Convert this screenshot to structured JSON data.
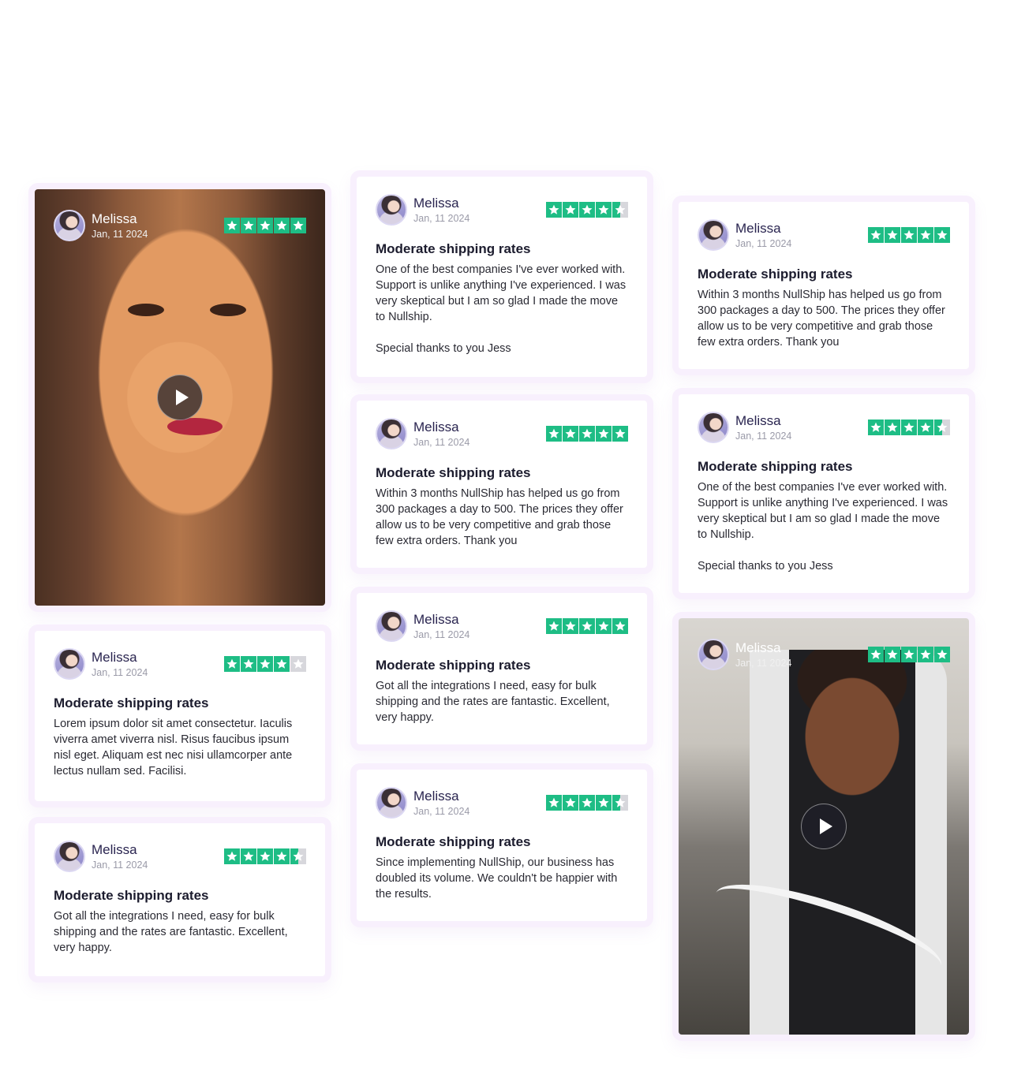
{
  "colors": {
    "star_on": "#1ebd85",
    "star_off": "#d7d7dc",
    "card_border": "#f8f0fd"
  },
  "cards": [
    {
      "kind": "video",
      "name": "Melissa",
      "date": "Jan, 11 2024",
      "rating": 5
    },
    {
      "kind": "text",
      "name": "Melissa",
      "date": "Jan, 11 2024",
      "rating": 4,
      "title": "Moderate shipping rates",
      "body": [
        "Lorem ipsum dolor sit amet consectetur. Iaculis viverra amet viverra nisl. Risus faucibus ipsum nisl eget. Aliquam est nec nisi ullamcorper ante lectus nullam sed. Facilisi."
      ]
    },
    {
      "kind": "text",
      "name": "Melissa",
      "date": "Jan, 11 2024",
      "rating": 4.5,
      "title": "Moderate shipping rates",
      "body": [
        "Got all the integrations I need, easy for bulk shipping and the rates are fantastic. Excellent, very happy."
      ]
    },
    {
      "kind": "text",
      "name": "Melissa",
      "date": "Jan, 11 2024",
      "rating": 4.5,
      "title": "Moderate shipping rates",
      "body": [
        "One of the best companies I've ever worked with. Support is unlike anything I've experienced. I was very skeptical but I am so glad I made the move to Nullship.",
        "Special thanks to you Jess"
      ]
    },
    {
      "kind": "text",
      "name": "Melissa",
      "date": "Jan, 11 2024",
      "rating": 5,
      "title": "Moderate shipping rates",
      "body": [
        "Within 3 months NullShip has helped us go from 300 packages a day to 500. The prices they offer allow us to be very competitive and grab those few extra orders. Thank you"
      ]
    },
    {
      "kind": "text",
      "name": "Melissa",
      "date": "Jan, 11 2024",
      "rating": 5,
      "title": "Moderate shipping rates",
      "body": [
        "Got all the integrations I need, easy for bulk shipping and the rates are fantastic. Excellent, very happy."
      ]
    },
    {
      "kind": "text",
      "name": "Melissa",
      "date": "Jan, 11 2024",
      "rating": 4.5,
      "title": "Moderate shipping rates",
      "body": [
        "Since implementing NullShip, our business has doubled its volume. We couldn't be happier with the results."
      ]
    },
    {
      "kind": "text",
      "name": "Melissa",
      "date": "Jan, 11 2024",
      "rating": 5,
      "title": "Moderate shipping rates",
      "body": [
        "Within 3 months NullShip has helped us go from 300 packages a day to 500. The prices they offer allow us to be very competitive and grab those few extra orders. Thank you"
      ]
    },
    {
      "kind": "text",
      "name": "Melissa",
      "date": "Jan, 11 2024",
      "rating": 4.5,
      "title": "Moderate shipping rates",
      "body": [
        "One of the best companies I've ever worked with. Support is unlike anything I've experienced. I was very skeptical but I am so glad I made the move to Nullship.",
        "Special thanks to you Jess"
      ]
    },
    {
      "kind": "video",
      "name": "Melissa",
      "date": "Jan, 11 2024",
      "rating": 5
    }
  ]
}
